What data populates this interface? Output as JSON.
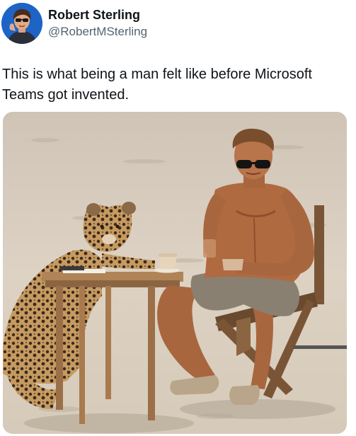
{
  "author": {
    "display_name": "Robert Sterling",
    "handle": "@RobertMSterling",
    "avatar_icon": "cartoon-avatar-icon"
  },
  "post": {
    "text": "This is what being a man felt like before Microsoft Teams got invented."
  },
  "media": {
    "type": "photo",
    "icon": "photo-icon"
  },
  "colors": {
    "text": "#0f1419",
    "secondary_text": "#536471",
    "avatar_bg": "#1d64c6",
    "sand": "#d9cfc1"
  }
}
